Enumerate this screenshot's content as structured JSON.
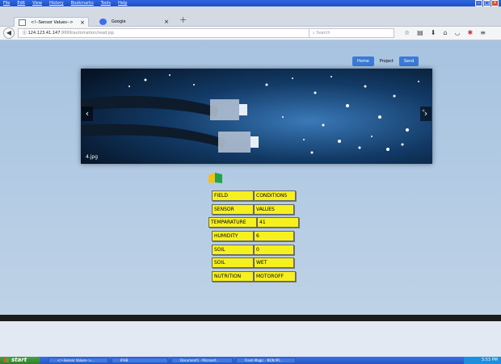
{
  "browser": {
    "menu": [
      "File",
      "Edit",
      "View",
      "History",
      "Bookmarks",
      "Tools",
      "Help"
    ],
    "tabs": [
      {
        "label": "<!--Sensor Values-->",
        "active": true
      },
      {
        "label": "Google",
        "active": false
      }
    ],
    "url_host": "124.123.41.147",
    "url_path": ":9999/automation/read.jsp",
    "search_placeholder": "Search"
  },
  "site_nav": {
    "home_label": "Home",
    "project_label": "Project",
    "send_label": "Send"
  },
  "carousel": {
    "caption": "4.jpg",
    "prev_icon": "chevron-left-icon",
    "next_icon": "chevron-right-icon"
  },
  "sensor_table": [
    {
      "label": "FIELD",
      "value": "CONDITIONS"
    },
    {
      "label": "SENSOR",
      "value": "VALUES"
    },
    {
      "label": "TEMPARATURE",
      "value": "41"
    },
    {
      "label": "HUMIDITY",
      "value": "6"
    },
    {
      "label": "SOIL",
      "value": "0"
    },
    {
      "label": "SOIL",
      "value": "WET"
    },
    {
      "label": "NUTRITION",
      "value": "MOTOROFF"
    }
  ],
  "taskbar": {
    "start_label": "start",
    "items": [
      "<!--Sensor Values-->...",
      "IPHB",
      "Document1 - Microsof...",
      "Flash Magic - NON PR..."
    ],
    "clock": "3:53 PM"
  },
  "colors": {
    "table_yellow": "#f5f01e",
    "accent_blue": "#3a7bd5"
  }
}
